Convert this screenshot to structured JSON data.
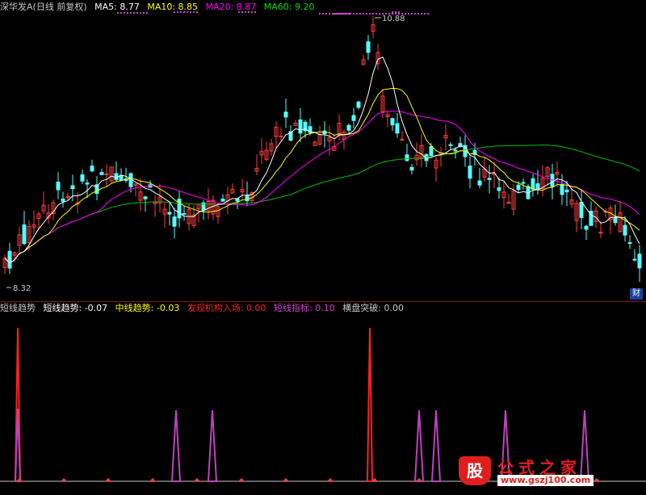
{
  "header": {
    "stock": "深华发A",
    "period": "(日线 前复权)",
    "ma5": "MA5: 8.77",
    "ma10": "MA10: 8.85",
    "ma20": "MA20: 8.87",
    "ma60": "MA60: 9.20"
  },
  "price": {
    "high": "10.88",
    "low": "8.32"
  },
  "cai_badge": "财",
  "indicator": {
    "name": "短线趋势",
    "short_trend": "短线趋势: -0.07",
    "mid_trend": "中线趋势: -0.03",
    "inst": "发现机构入场: 0.00",
    "short_index": "短线指标: 0.10",
    "breakout": "横盘突破: 0.00"
  },
  "colors": {
    "up": "#ff3b3b",
    "down": "#54ffff",
    "ma5": "#ffffff",
    "ma10": "#ffff00",
    "ma20": "#ff00ff",
    "ma60": "#00c000",
    "inst": "#ff2020",
    "short_index": "#c040c0"
  },
  "watermark": {
    "logo": "股",
    "brand": "公式之家",
    "url": "www.gszj100.com"
  }
}
